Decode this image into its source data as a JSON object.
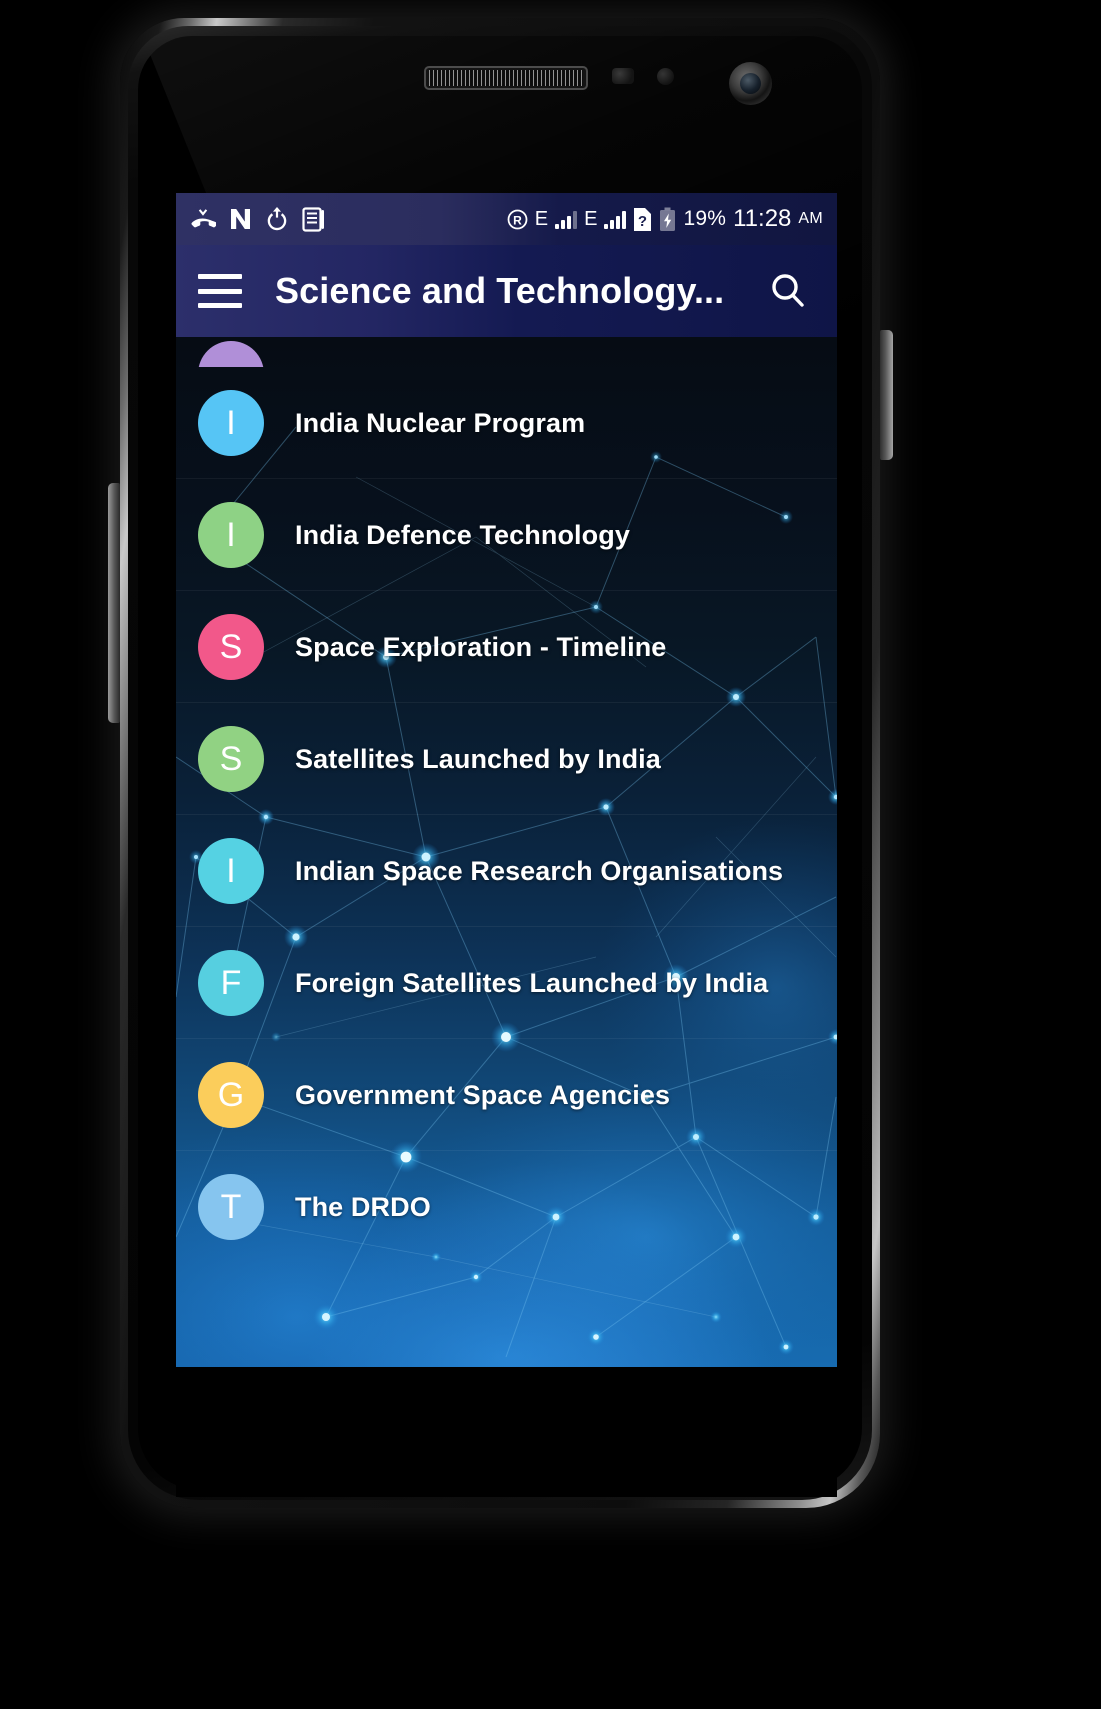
{
  "status_bar": {
    "left_icons": [
      {
        "name": "missed-call-icon",
        "glyph": "missed-call"
      },
      {
        "name": "nfc-icon",
        "glyph": "N"
      },
      {
        "name": "software-update-icon",
        "glyph": "power-up"
      },
      {
        "name": "notification-document-icon",
        "glyph": "document"
      }
    ],
    "right_icons": [
      {
        "name": "roaming-icon",
        "glyph": "R"
      },
      {
        "name": "network-type-sim1",
        "glyph": "E"
      },
      {
        "name": "signal-bars-sim1",
        "glyph": "bars"
      },
      {
        "name": "network-type-sim2",
        "glyph": "E"
      },
      {
        "name": "signal-bars-sim2",
        "glyph": "bars"
      },
      {
        "name": "sim-unknown-icon",
        "glyph": "?"
      },
      {
        "name": "battery-charging-icon",
        "glyph": "battery"
      }
    ],
    "battery_percent": "19%",
    "time": "11:28",
    "am_pm": "AM"
  },
  "app_bar": {
    "menu_label": "menu",
    "title": "Science and Technology...",
    "search_label": "search"
  },
  "list": {
    "partial_top_item": {
      "initial": "",
      "color": "#b08fd8"
    },
    "items": [
      {
        "initial": "I",
        "label": "India Nuclear Program",
        "color": "#56c5f5"
      },
      {
        "initial": "I",
        "label": "India Defence Technology",
        "color": "#8ed285"
      },
      {
        "initial": "S",
        "label": "Space Exploration - Timeline",
        "color": "#f2588a"
      },
      {
        "initial": "S",
        "label": "Satellites Launched by India",
        "color": "#91d283"
      },
      {
        "initial": "I",
        "label": "Indian Space Research Organisations",
        "color": "#55d2e3"
      },
      {
        "initial": "F",
        "label": "Foreign Satellites Launched by India",
        "color": "#56cfe0"
      },
      {
        "initial": "G",
        "label": "Government Space Agencies",
        "color": "#fbcd5b"
      },
      {
        "initial": "T",
        "label": "The DRDO",
        "color": "#86c5ef"
      }
    ]
  },
  "colors": {
    "status_bar_bg": "#1b2050",
    "app_bar_bg": "#171d55",
    "text_primary": "#ffffff",
    "background_top": "#060c14",
    "background_bottom": "#176bb0"
  }
}
